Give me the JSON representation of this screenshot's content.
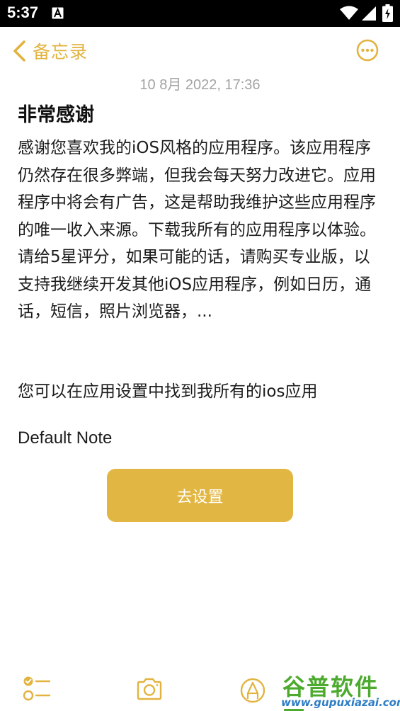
{
  "status_bar": {
    "time": "5:37",
    "icons": [
      "a-notification-icon",
      "wifi-icon",
      "signal-icon",
      "battery-icon"
    ]
  },
  "nav": {
    "back_label": "备忘录",
    "accent_color": "#e2b33f"
  },
  "note": {
    "date": "10 8月 2022, 17:36",
    "title": "非常感谢",
    "body": "感谢您喜欢我的iOS风格的应用程序。该应用程序仍然存在很多弊端，但我会每天努力改进它。应用程序中将会有广告，这是帮助我维护这些应用程序的唯一收入来源。下载我所有的应用程序以体验。请给5星评分，如果可能的话，请购买专业版，以支持我继续开发其他iOS应用程序，例如日历，通话，短信，照片浏览器，...",
    "footer_text": "您可以在应用设置中找到我所有的ios应用",
    "default_label": "Default Note"
  },
  "settings_button": {
    "label": "去设置",
    "color": "#e2b642"
  },
  "toolbar": {
    "icons": [
      "checklist-icon",
      "camera-icon",
      "markup-pen-icon"
    ]
  },
  "watermark": {
    "main": "谷普软件园",
    "sub": "www.gupuxiazai.com"
  }
}
